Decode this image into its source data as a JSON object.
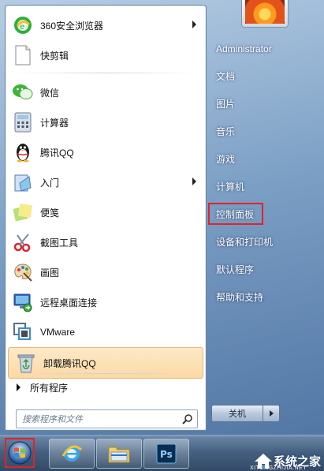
{
  "start_menu": {
    "programs": [
      {
        "label": "360安全浏览器",
        "icon": "browser-360-icon",
        "has_submenu": true
      },
      {
        "label": "快剪辑",
        "icon": "document-icon",
        "has_submenu": false
      },
      {
        "label": "微信",
        "icon": "wechat-icon",
        "has_submenu": false
      },
      {
        "label": "计算器",
        "icon": "calculator-icon",
        "has_submenu": false
      },
      {
        "label": "腾讯QQ",
        "icon": "qq-penguin-icon",
        "has_submenu": false
      },
      {
        "label": "入门",
        "icon": "getting-started-icon",
        "has_submenu": true
      },
      {
        "label": "便笺",
        "icon": "sticky-notes-icon",
        "has_submenu": false
      },
      {
        "label": "截图工具",
        "icon": "scissors-icon",
        "has_submenu": false
      },
      {
        "label": "画图",
        "icon": "paint-palette-icon",
        "has_submenu": false
      },
      {
        "label": "远程桌面连接",
        "icon": "remote-desktop-icon",
        "has_submenu": false
      },
      {
        "label": "VMware",
        "icon": "vmware-icon",
        "has_submenu": false
      },
      {
        "label": "卸载腾讯QQ",
        "icon": "recycle-bin-icon",
        "has_submenu": false,
        "highlighted": true
      }
    ],
    "all_programs": "所有程序",
    "search_placeholder": "搜索程序和文件",
    "right_items": [
      {
        "label": "Administrator"
      },
      {
        "label": "文档"
      },
      {
        "label": "图片"
      },
      {
        "label": "音乐"
      },
      {
        "label": "游戏"
      },
      {
        "label": "计算机"
      },
      {
        "label": "控制面板",
        "boxed": true
      },
      {
        "label": "设备和打印机"
      },
      {
        "label": "默认程序"
      },
      {
        "label": "帮助和支持"
      }
    ],
    "shutdown_label": "关机"
  },
  "taskbar": {
    "buttons": [
      "start-orb-icon",
      "ie-browser-icon",
      "file-explorer-icon",
      "photoshop-icon"
    ],
    "photoshop_text": "Ps"
  },
  "watermark": {
    "text": "系统之家",
    "sub": "XITONGZHIJIA.NET"
  },
  "colors": {
    "highlight_box": "#e2222a",
    "hover_bg": "#fbd9a4"
  }
}
